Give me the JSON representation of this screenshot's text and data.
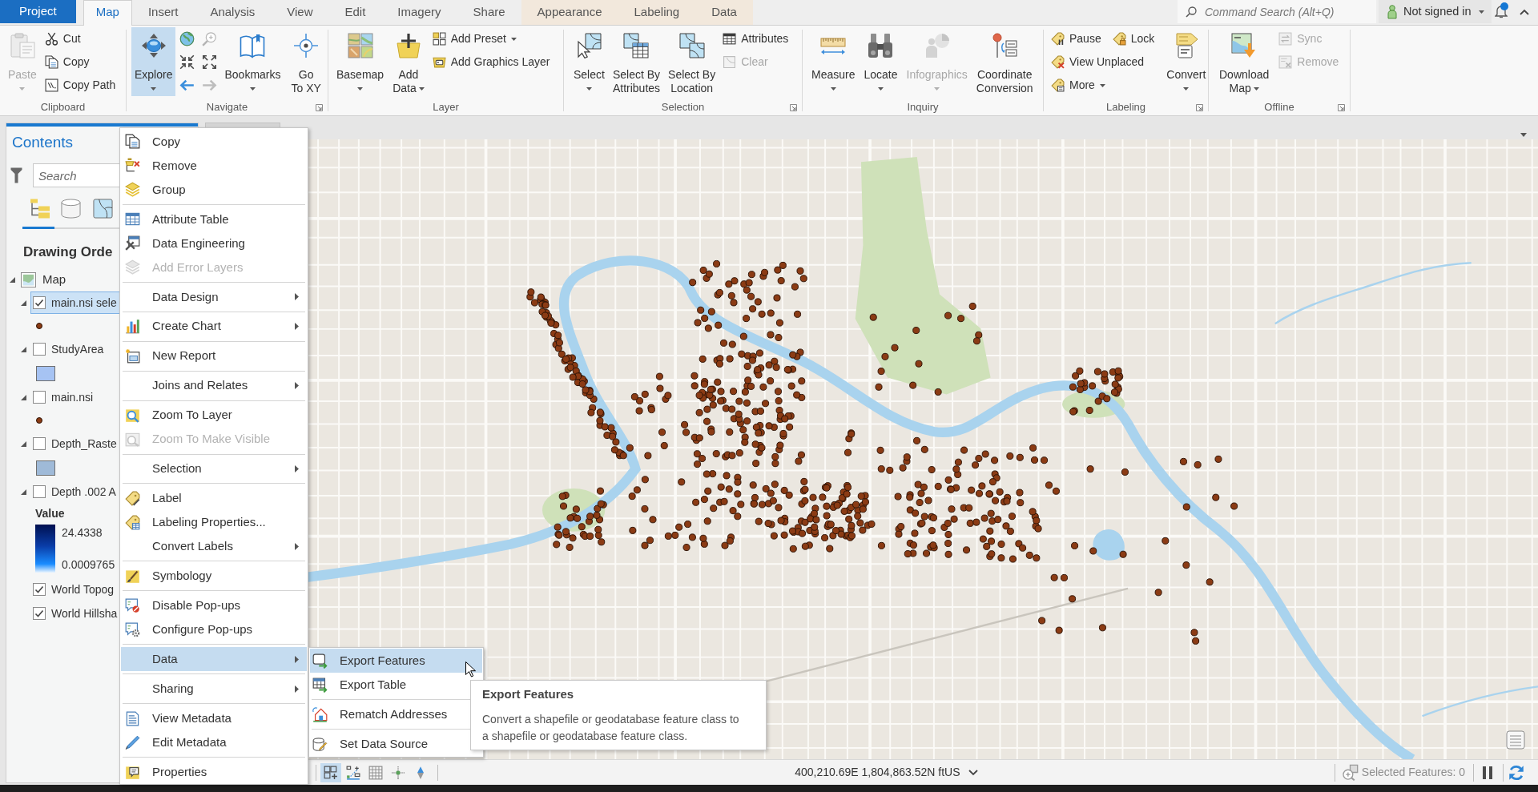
{
  "ribbon_tabs": [
    {
      "label": "Project",
      "kind": "backstage",
      "selected": false
    },
    {
      "label": "Map",
      "kind": "core",
      "selected": true
    },
    {
      "label": "Insert",
      "kind": "core",
      "selected": false
    },
    {
      "label": "Analysis",
      "kind": "core",
      "selected": false
    },
    {
      "label": "View",
      "kind": "core",
      "selected": false
    },
    {
      "label": "Edit",
      "kind": "core",
      "selected": false
    },
    {
      "label": "Imagery",
      "kind": "core",
      "selected": false
    },
    {
      "label": "Share",
      "kind": "core",
      "selected": false
    },
    {
      "label": "Appearance",
      "kind": "contextual",
      "selected": false
    },
    {
      "label": "Labeling",
      "kind": "contextual",
      "selected": false
    },
    {
      "label": "Data",
      "kind": "contextual",
      "selected": false
    }
  ],
  "command_search": {
    "placeholder": "Command Search (Alt+Q)"
  },
  "account": {
    "label": "Not signed in",
    "unread": true
  },
  "ribbon": {
    "groups": [
      {
        "label": "Clipboard",
        "launcher": false,
        "columns": [
          {
            "kind": "large",
            "lines": [
              "Paste"
            ],
            "dropdown": true,
            "disabled": true,
            "selected": false
          },
          {
            "kind": "stack",
            "rows": [
              [
                {
                  "label": "Cut",
                  "dropdown": false,
                  "disabled": false
                }
              ],
              [
                {
                  "label": "Copy",
                  "dropdown": false,
                  "disabled": false
                }
              ],
              [
                {
                  "label": "Copy Path",
                  "dropdown": false,
                  "disabled": false
                }
              ]
            ]
          }
        ]
      },
      {
        "label": "Navigate",
        "launcher": true,
        "columns": [
          {
            "kind": "large",
            "lines": [
              "Explore"
            ],
            "dropdown": true,
            "disabled": false,
            "selected": true
          },
          {
            "kind": "tools",
            "items": [
              {
                "disabled": false
              },
              {
                "disabled": true
              },
              {
                "disabled": false
              },
              {
                "disabled": false
              },
              {
                "disabled": false
              },
              {
                "disabled": true
              }
            ]
          },
          {
            "kind": "large",
            "lines": [
              "Bookmarks"
            ],
            "dropdown": true,
            "disabled": false,
            "selected": false
          },
          {
            "kind": "large",
            "lines": [
              "Go",
              "To XY"
            ],
            "dropdown": false,
            "disabled": false,
            "selected": false
          }
        ]
      },
      {
        "label": "Layer",
        "launcher": false,
        "columns": [
          {
            "kind": "large",
            "lines": [
              "Basemap"
            ],
            "dropdown": true,
            "disabled": false,
            "selected": false
          },
          {
            "kind": "large",
            "lines": [
              "Add",
              "Data"
            ],
            "dropdown": true,
            "disabled": false,
            "selected": false
          },
          {
            "kind": "stack",
            "rows": [
              [
                {
                  "label": "Add Preset",
                  "dropdown": true,
                  "disabled": false
                }
              ],
              [
                {
                  "label": "Add Graphics Layer",
                  "dropdown": false,
                  "disabled": false
                }
              ]
            ]
          }
        ]
      },
      {
        "label": "Selection",
        "launcher": true,
        "columns": [
          {
            "kind": "large",
            "lines": [
              "Select"
            ],
            "dropdown": true,
            "disabled": false,
            "selected": false
          },
          {
            "kind": "large",
            "lines": [
              "Select By",
              "Attributes"
            ],
            "dropdown": false,
            "disabled": false,
            "selected": false
          },
          {
            "kind": "large",
            "lines": [
              "Select By",
              "Location"
            ],
            "dropdown": false,
            "disabled": false,
            "selected": false
          },
          {
            "kind": "stack",
            "rows": [
              [
                {
                  "label": "Attributes",
                  "dropdown": false,
                  "disabled": false
                }
              ],
              [
                {
                  "label": "Clear",
                  "dropdown": false,
                  "disabled": true
                }
              ]
            ]
          }
        ]
      },
      {
        "label": "Inquiry",
        "launcher": false,
        "columns": [
          {
            "kind": "large",
            "lines": [
              "Measure"
            ],
            "dropdown": true,
            "disabled": false,
            "selected": false
          },
          {
            "kind": "large",
            "lines": [
              "Locate"
            ],
            "dropdown": true,
            "disabled": false,
            "selected": false
          },
          {
            "kind": "large",
            "lines": [
              "Infographics"
            ],
            "dropdown": true,
            "disabled": true,
            "selected": false
          },
          {
            "kind": "large",
            "lines": [
              "Coordinate",
              "Conversion"
            ],
            "dropdown": false,
            "disabled": false,
            "selected": false
          }
        ]
      },
      {
        "label": "Labeling",
        "launcher": true,
        "columns": [
          {
            "kind": "stack",
            "rows": [
              [
                {
                  "label": "Pause",
                  "dropdown": false,
                  "disabled": false
                },
                {
                  "label": "Lock",
                  "dropdown": false,
                  "disabled": false
                }
              ],
              [
                {
                  "label": "View Unplaced",
                  "dropdown": false,
                  "disabled": false
                }
              ],
              [
                {
                  "label": "More",
                  "dropdown": true,
                  "disabled": false
                }
              ]
            ]
          },
          {
            "kind": "large",
            "lines": [
              "Convert"
            ],
            "dropdown": true,
            "disabled": false,
            "selected": false
          }
        ]
      },
      {
        "label": "Offline",
        "launcher": true,
        "columns": [
          {
            "kind": "large",
            "lines": [
              "Download",
              "Map"
            ],
            "dropdown": true,
            "disabled": false,
            "selected": false
          },
          {
            "kind": "stack",
            "rows": [
              [
                {
                  "label": "Sync",
                  "dropdown": false,
                  "disabled": true
                }
              ],
              [
                {
                  "label": "Remove",
                  "dropdown": false,
                  "disabled": true
                }
              ]
            ]
          }
        ]
      }
    ]
  },
  "contents": {
    "title": "Contents",
    "search": {
      "placeholder": "Search"
    },
    "view_tabs": [
      {
        "selected": true
      },
      {
        "selected": false
      },
      {
        "selected": false
      }
    ],
    "heading": "Drawing Orde",
    "tree": [
      {
        "label": "Map",
        "expanded": true,
        "children": [
          {
            "label": "main.nsi sele",
            "checked": true,
            "selected": true,
            "expanded": true,
            "legend": {
              "kind": "point",
              "color": "#8b3b14"
            }
          },
          {
            "label": "StudyArea",
            "checked": false,
            "selected": false,
            "expanded": true,
            "legend": {
              "kind": "fill",
              "color": "#a6c3f3"
            }
          },
          {
            "label": "main.nsi",
            "checked": false,
            "selected": false,
            "expanded": true,
            "legend": {
              "kind": "point",
              "color": "#8b3b14"
            }
          },
          {
            "label": "Depth_Raste",
            "checked": false,
            "selected": false,
            "expanded": true,
            "legend": {
              "kind": "fill",
              "color": "#9fbad8"
            }
          },
          {
            "label": "Depth .002 A",
            "checked": false,
            "selected": false,
            "expanded": true,
            "legend": {
              "kind": "ramp",
              "label": "Value",
              "high": "24.4338",
              "low": "0.0009765"
            }
          },
          {
            "label": "World Topog",
            "checked": true,
            "selected": false,
            "expanded": false
          },
          {
            "label": "World Hillsha",
            "checked": true,
            "selected": false,
            "expanded": false
          }
        ]
      }
    ]
  },
  "map_view": {
    "tools": [
      {
        "selected": true
      },
      {
        "selected": false
      },
      {
        "selected": false
      },
      {
        "selected": false
      },
      {
        "selected": false
      }
    ],
    "coordinates": "400,210.69E 1,804,863.52N ftUS",
    "selected_features": "Selected Features: 0"
  },
  "context_menu": {
    "sections": [
      {
        "items": [
          {
            "label": "Copy",
            "disabled": false,
            "submenu": false,
            "selected": false
          },
          {
            "label": "Remove",
            "disabled": false,
            "submenu": false,
            "selected": false
          },
          {
            "label": "Group",
            "disabled": false,
            "submenu": false,
            "selected": false
          }
        ]
      },
      {
        "items": [
          {
            "label": "Attribute Table",
            "disabled": false,
            "submenu": false,
            "selected": false
          },
          {
            "label": "Data Engineering",
            "disabled": false,
            "submenu": false,
            "selected": false
          },
          {
            "label": "Add Error Layers",
            "disabled": true,
            "submenu": false,
            "selected": false
          }
        ]
      },
      {
        "items": [
          {
            "label": "Data Design",
            "disabled": false,
            "submenu": true,
            "selected": false
          }
        ]
      },
      {
        "items": [
          {
            "label": "Create Chart",
            "disabled": false,
            "submenu": true,
            "selected": false
          }
        ]
      },
      {
        "items": [
          {
            "label": "New Report",
            "disabled": false,
            "submenu": false,
            "selected": false
          }
        ]
      },
      {
        "items": [
          {
            "label": "Joins and Relates",
            "disabled": false,
            "submenu": true,
            "selected": false
          }
        ]
      },
      {
        "items": [
          {
            "label": "Zoom To Layer",
            "disabled": false,
            "submenu": false,
            "selected": false
          },
          {
            "label": "Zoom To Make Visible",
            "disabled": true,
            "submenu": false,
            "selected": false
          }
        ]
      },
      {
        "items": [
          {
            "label": "Selection",
            "disabled": false,
            "submenu": true,
            "selected": false
          }
        ]
      },
      {
        "items": [
          {
            "label": "Label",
            "disabled": false,
            "submenu": false,
            "selected": false
          },
          {
            "label": "Labeling Properties...",
            "disabled": false,
            "submenu": false,
            "selected": false
          },
          {
            "label": "Convert Labels",
            "disabled": false,
            "submenu": true,
            "selected": false
          }
        ]
      },
      {
        "items": [
          {
            "label": "Symbology",
            "disabled": false,
            "submenu": false,
            "selected": false
          }
        ]
      },
      {
        "items": [
          {
            "label": "Disable Pop-ups",
            "disabled": false,
            "submenu": false,
            "selected": false
          },
          {
            "label": "Configure Pop-ups",
            "disabled": false,
            "submenu": false,
            "selected": false
          }
        ]
      },
      {
        "items": [
          {
            "label": "Data",
            "disabled": false,
            "submenu": true,
            "selected": true
          }
        ]
      },
      {
        "items": [
          {
            "label": "Sharing",
            "disabled": false,
            "submenu": true,
            "selected": false
          }
        ]
      },
      {
        "items": [
          {
            "label": "View Metadata",
            "disabled": false,
            "submenu": false,
            "selected": false
          },
          {
            "label": "Edit Metadata",
            "disabled": false,
            "submenu": false,
            "selected": false
          }
        ]
      },
      {
        "items": [
          {
            "label": "Properties",
            "disabled": false,
            "submenu": false,
            "selected": false
          }
        ]
      }
    ]
  },
  "data_submenu": {
    "sections": [
      {
        "items": [
          {
            "label": "Export Features",
            "selected": true
          },
          {
            "label": "Export Table",
            "selected": false
          }
        ]
      },
      {
        "items": [
          {
            "label": "Rematch Addresses",
            "selected": false
          }
        ]
      },
      {
        "items": [
          {
            "label": "Set Data Source",
            "selected": false
          }
        ]
      }
    ]
  },
  "tooltip": {
    "title": "Export Features",
    "text": "Convert a shapefile or geodatabase feature class to a shapefile or geodatabase feature class."
  }
}
